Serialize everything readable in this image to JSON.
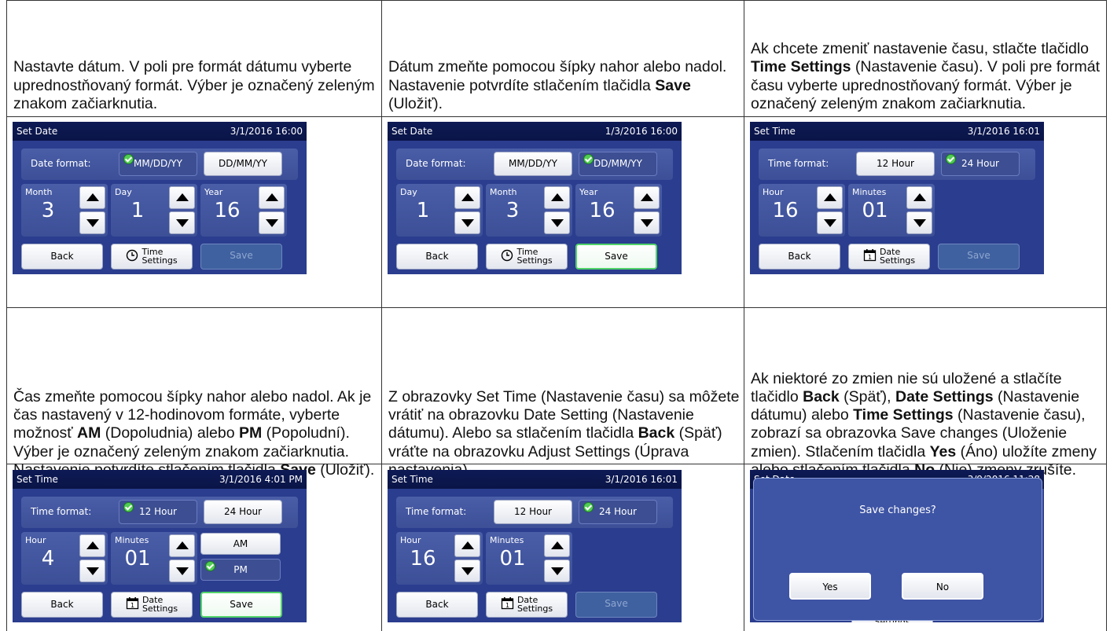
{
  "cells": [
    {
      "text_html": "Nastavte dátum. V poli pre formát dátumu vyberte uprednostňovaný formát. Výber je označený zeleným znakom začiarknutia.",
      "screen": {
        "title": "Set Date",
        "datetime": "3/1/2016 16:00",
        "format_label": "Date format:",
        "format_options": [
          "MM/DD/YY",
          "DD/MM/YY"
        ],
        "selected": 0,
        "spinners": [
          {
            "label": "Month",
            "value": "3"
          },
          {
            "label": "Day",
            "value": "1"
          },
          {
            "label": "Year",
            "value": "16"
          }
        ],
        "buttons": {
          "back": "Back",
          "settings_line1": "Time",
          "settings_line2": "Settings",
          "settings_icon": "clock-icon",
          "save": "Save",
          "save_enabled": false
        }
      }
    },
    {
      "text_html": "Dátum zmeňte pomocou šípky nahor alebo nadol. Nastavenie potvrdíte stlačením tlačidla <b>Save</b> (Uložiť).",
      "screen": {
        "title": "Set Date",
        "datetime": "1/3/2016 16:00",
        "format_label": "Date format:",
        "format_options": [
          "MM/DD/YY",
          "DD/MM/YY"
        ],
        "selected": 1,
        "spinners": [
          {
            "label": "Day",
            "value": "1"
          },
          {
            "label": "Month",
            "value": "3"
          },
          {
            "label": "Year",
            "value": "16"
          }
        ],
        "buttons": {
          "back": "Back",
          "settings_line1": "Time",
          "settings_line2": "Settings",
          "settings_icon": "clock-icon",
          "save": "Save",
          "save_enabled": true
        }
      }
    },
    {
      "text_html": "Ak chcete zmeniť nastavenie času, stlačte tlačidlo <b>Time Settings</b> (Nastavenie času). V poli pre formát času vyberte uprednostňovaný formát. Výber je označený zeleným znakom začiarknutia.",
      "screen": {
        "title": "Set Time",
        "datetime": "3/1/2016 16:01",
        "format_label": "Time format:",
        "format_options": [
          "12 Hour",
          "24 Hour"
        ],
        "selected": 1,
        "spinners": [
          {
            "label": "Hour",
            "value": "16"
          },
          {
            "label": "Minutes",
            "value": "01"
          }
        ],
        "buttons": {
          "back": "Back",
          "settings_line1": "Date",
          "settings_line2": "Settings",
          "settings_icon": "calendar-icon",
          "save": "Save",
          "save_enabled": false
        }
      }
    },
    {
      "text_html": "Čas zmeňte pomocou šípky nahor alebo nadol. Ak je čas nastavený v 12-hodinovom formáte, vyberte možnosť <b>AM</b> (Dopoludnia) alebo <b>PM</b> (Popoludní). Výber je označený zeleným znakom začiarknutia. Nastavenie potvrdíte stlačením tlačidla <b>Save</b> (Uložiť).",
      "screen": {
        "title": "Set Time",
        "datetime": "3/1/2016 4:01 PM",
        "format_label": "Time format:",
        "format_options": [
          "12 Hour",
          "24 Hour"
        ],
        "selected": 0,
        "spinners": [
          {
            "label": "Hour",
            "value": "4"
          },
          {
            "label": "Minutes",
            "value": "01"
          }
        ],
        "ampm": {
          "am": "AM",
          "pm": "PM",
          "selected": "pm"
        },
        "buttons": {
          "back": "Back",
          "settings_line1": "Date",
          "settings_line2": "Settings",
          "settings_icon": "calendar-icon",
          "save": "Save",
          "save_enabled": true
        }
      }
    },
    {
      "text_html": "Z obrazovky Set Time (Nastavenie času) sa môžete vrátiť na obrazovku Date Setting (Nastavenie dátumu). Alebo sa stlačením tlačidla <b>Back</b> (Späť) vráťte na obrazovku Adjust Settings (Úprava nastavenia).",
      "screen": {
        "title": "Set Time",
        "datetime": "3/1/2016 16:01",
        "format_label": "Time format:",
        "format_options": [
          "12 Hour",
          "24 Hour"
        ],
        "selected": 1,
        "spinners": [
          {
            "label": "Hour",
            "value": "16"
          },
          {
            "label": "Minutes",
            "value": "01"
          }
        ],
        "buttons": {
          "back": "Back",
          "settings_line1": "Date",
          "settings_line2": "Settings",
          "settings_icon": "calendar-icon",
          "save": "Save",
          "save_enabled": false
        }
      }
    },
    {
      "text_html": "Ak niektoré zo zmien nie sú uložené a stlačíte tlačidlo <b>Back</b> (Späť), <b>Date Settings</b> (Nastavenie dátumu) alebo <b>Time Settings</b> (Nastavenie času), zobrazí sa obrazovka Save changes (Uloženie zmien). Stlačením tlačidla <b>Yes</b> (Áno) uložíte zmeny alebo stlačením tlačidla <b>No</b> (Nie) zmeny zrušíte.",
      "dialog_screen": {
        "title": "Set Date",
        "datetime": "3/9/2016 11:28",
        "message": "Save changes?",
        "yes": "Yes",
        "no": "No",
        "behind_label": "Settings"
      }
    }
  ]
}
